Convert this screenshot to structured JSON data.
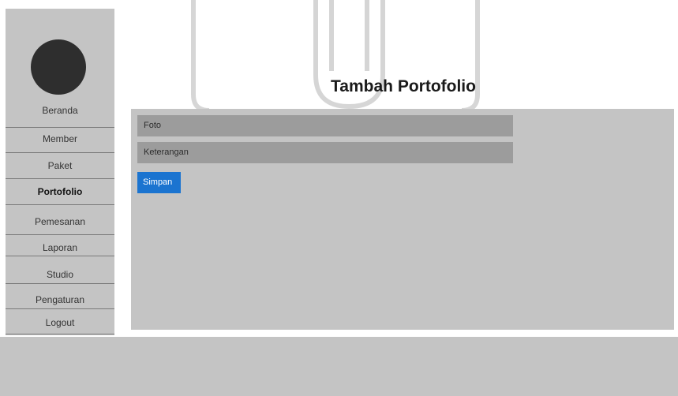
{
  "page": {
    "title": "Tambah Portofolio"
  },
  "sidebar": {
    "items": [
      {
        "label": "Beranda",
        "active": false
      },
      {
        "label": "Member",
        "active": false
      },
      {
        "label": "Paket",
        "active": false
      },
      {
        "label": "Portofolio",
        "active": true
      },
      {
        "label": "Pemesanan",
        "active": false
      },
      {
        "label": "Laporan",
        "active": false
      },
      {
        "label": "Studio",
        "active": false
      },
      {
        "label": "Pengaturan",
        "active": false
      },
      {
        "label": "Logout",
        "active": false
      }
    ]
  },
  "form": {
    "foto_placeholder": "Foto",
    "keterangan_placeholder": "Keterangan",
    "save_label": "Simpan"
  },
  "colors": {
    "panel": "#c4c4c4",
    "field": "#9c9c9c",
    "button": "#1b74d0",
    "avatar": "#2e2e2e"
  }
}
